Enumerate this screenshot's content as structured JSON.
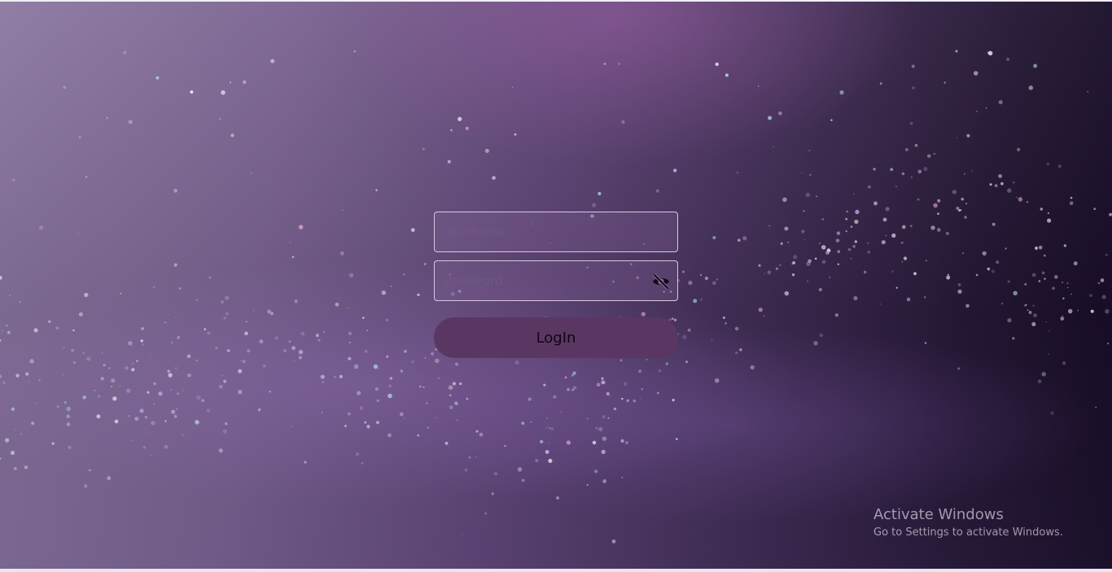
{
  "login": {
    "username_placeholder": "username",
    "username_value": "",
    "password_placeholder": "password",
    "password_value": "",
    "password_toggle_icon": "eye-slash-icon",
    "button_label": "LogIn"
  },
  "watermark": {
    "title": "Activate Windows",
    "subtitle": "Go to Settings to activate Windows."
  },
  "colors": {
    "button": "#5a3763",
    "field_border": "#d9c8e4",
    "background_dark": "#140a20",
    "background_light": "#8d7aa2"
  }
}
